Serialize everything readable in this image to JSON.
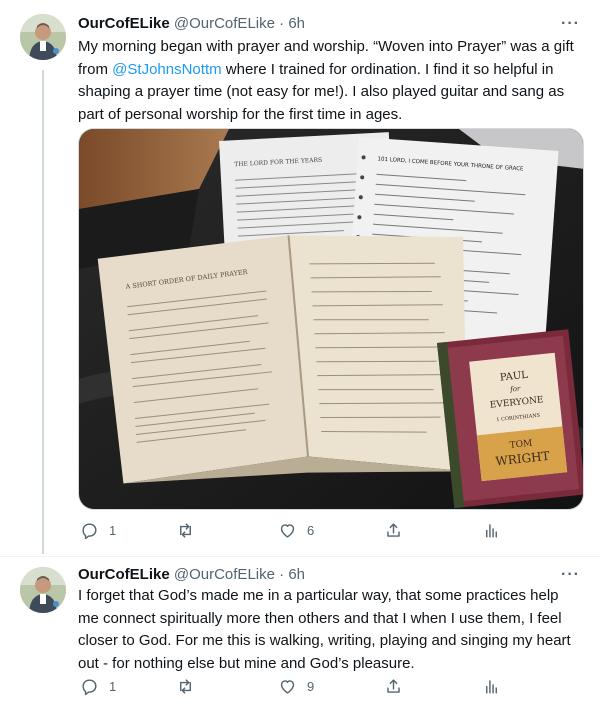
{
  "tweets": [
    {
      "name": "OurCofELike",
      "handle": "@OurCofELike",
      "dot": "·",
      "time": "6h",
      "more": "···",
      "text_before": "My morning began with prayer and worship. “Woven into Prayer” was a gift from ",
      "mention": "@StJohnsNottm",
      "text_after": " where I trained for ordination. I find it so helpful in shaping a prayer time (not easy for me!). I also played guitar and sang as part of personal worship for the first time in ages.",
      "media": {
        "book_lines": [
          "PAUL",
          "for",
          "EVERYONE",
          "1 CORINTHIANS",
          "TOM",
          "WRIGHT"
        ],
        "left_page_heading": "A SHORT ORDER OF DAILY PRAYER",
        "top_sheet_heading": "101 LORD, I COME BEFORE YOUR THRONE OF GRACE",
        "left_sheet_heading": "THE LORD FOR THE YEARS"
      },
      "replies": "1",
      "retweets": "",
      "likes": "6"
    },
    {
      "name": "OurCofELike",
      "handle": "@OurCofELike",
      "dot": "·",
      "time": "6h",
      "more": "···",
      "text": "I forget that God’s made me in a particular way, that some practices help me connect spiritually more then others and that I when I use them, I feel closer to God. For me this is walking, writing, playing and singing my heart out - for nothing else but mine and God’s pleasure.",
      "replies": "1",
      "retweets": "",
      "likes": "9"
    }
  ],
  "colors": {
    "accent": "#1d9bf0",
    "muted": "#536471",
    "thread_line": "#cfd9de"
  },
  "icons": [
    "reply-icon",
    "retweet-icon",
    "like-icon",
    "share-icon",
    "stats-icon",
    "more-icon"
  ]
}
